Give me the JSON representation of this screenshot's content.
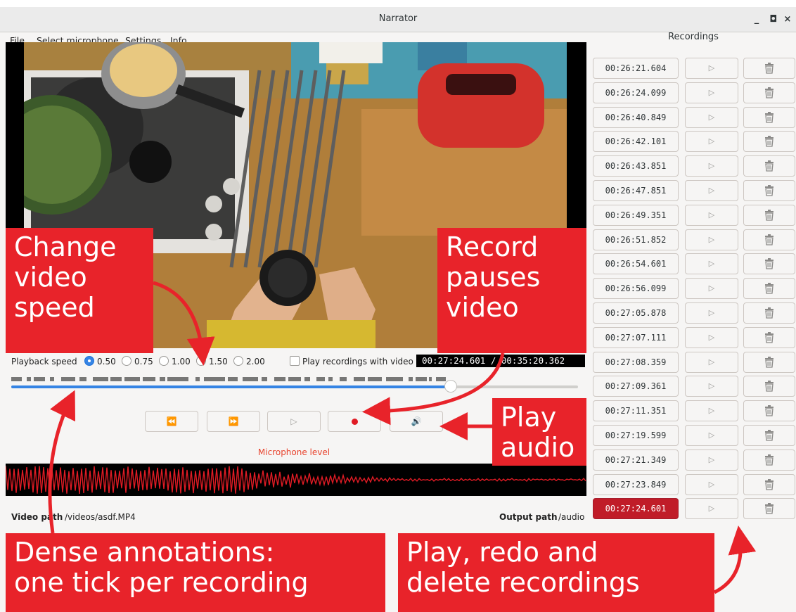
{
  "window": {
    "title": "Narrator",
    "controls": {
      "minimize": "_",
      "maximize": "◘",
      "close": "×"
    }
  },
  "menu": [
    "File",
    "Select microphone",
    "Settings",
    "Info"
  ],
  "playback": {
    "label": "Playback speed",
    "speeds": [
      "0.50",
      "0.75",
      "1.00",
      "1.50",
      "2.00"
    ],
    "selected_speed": "0.50",
    "play_with_video_label": "Play recordings with video",
    "play_with_video_checked": false,
    "timecode": "00:27:24.601 / 00:35:20.362",
    "position_fraction": 0.776
  },
  "controls": {
    "rewind_icon": "⏪",
    "forward_icon": "⏩",
    "play_icon": "▷",
    "record_icon": "record-dot",
    "audio_icon": "🔊"
  },
  "mic_level_label": "Microphone level",
  "paths": {
    "video_label": "Video path",
    "video_value": "/videos/asdf.MP4",
    "output_label": "Output path",
    "output_value": "/audio"
  },
  "recordings": {
    "title": "Recordings",
    "play_icon": "▷",
    "delete_icon": "trash-icon",
    "active_color": "#c01c28",
    "items": [
      "00:26:21.604",
      "00:26:24.099",
      "00:26:40.849",
      "00:26:42.101",
      "00:26:43.851",
      "00:26:47.851",
      "00:26:49.351",
      "00:26:51.852",
      "00:26:54.601",
      "00:26:56.099",
      "00:27:05.878",
      "00:27:07.111",
      "00:27:08.359",
      "00:27:09.361",
      "00:27:11.351",
      "00:27:19.599",
      "00:27:21.349",
      "00:27:23.849",
      "00:27:24.601"
    ],
    "active_index": 18
  },
  "annotations": {
    "change_speed": "Change\nvideo\nspeed",
    "record_pauses": "Record\npauses\nvideo",
    "play_audio": "Play\naudio",
    "dense": "Dense annotations:\none tick per recording",
    "play_redo": "Play, redo and\ndelete recordings",
    "annotation_color": "#e8232a"
  }
}
